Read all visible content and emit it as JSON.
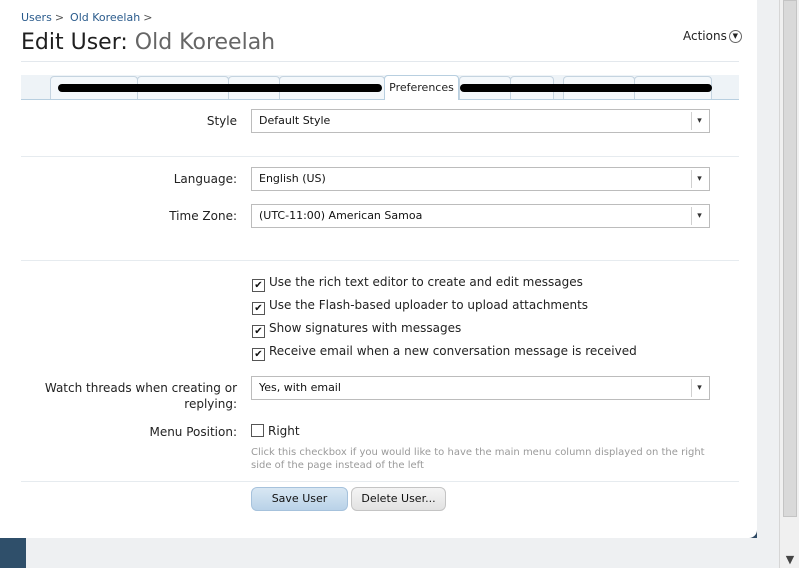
{
  "breadcrumb": {
    "items": [
      "Users",
      "Old Koreelah"
    ],
    "separator": ">"
  },
  "title": {
    "prefix": "Edit User:",
    "name": "Old Koreelah"
  },
  "actions": {
    "label": "Actions"
  },
  "tabs": {
    "active_label": "Preferences"
  },
  "form": {
    "style": {
      "label": "Style",
      "value": "Default Style"
    },
    "language": {
      "label": "Language:",
      "value": "English (US)"
    },
    "timezone": {
      "label": "Time Zone:",
      "value": "(UTC-11:00) American Samoa"
    },
    "checkboxes": [
      {
        "label": "Use the rich text editor to create and edit messages",
        "checked": true
      },
      {
        "label": "Use the Flash-based uploader to upload attachments",
        "checked": true
      },
      {
        "label": "Show signatures with messages",
        "checked": true
      },
      {
        "label": "Receive email when a new conversation message is received",
        "checked": true
      }
    ],
    "watch": {
      "label_line1": "Watch threads when creating or",
      "label_line2": "replying:",
      "value": "Yes, with email"
    },
    "menu_position": {
      "label": "Menu Position:",
      "option": "Right",
      "checked": false,
      "hint": "Click this checkbox if you would like to have the main menu column displayed on the right side of the page instead of the left"
    }
  },
  "buttons": {
    "save": "Save User",
    "delete": "Delete User..."
  },
  "colors": {
    "link": "#2a5b8c",
    "background": "#3b5f80"
  }
}
